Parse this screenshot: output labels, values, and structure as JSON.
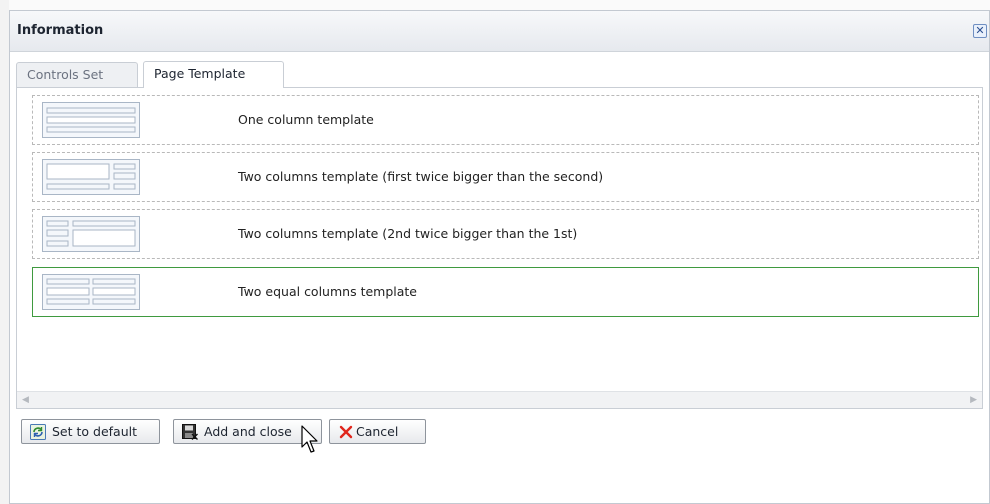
{
  "dialog": {
    "title": "Information"
  },
  "tabs": [
    {
      "label": "Controls Set",
      "active": false
    },
    {
      "label": "Page Template",
      "active": true
    }
  ],
  "templates": [
    {
      "label": "One column template",
      "selected": false,
      "thumb": "one-column"
    },
    {
      "label": "Two columns template (first twice bigger than the second)",
      "selected": false,
      "thumb": "wide-narrow"
    },
    {
      "label": "Two columns template (2nd twice bigger than the 1st)",
      "selected": false,
      "thumb": "narrow-wide"
    },
    {
      "label": "Two equal columns template",
      "selected": true,
      "thumb": "equal-columns"
    }
  ],
  "buttons": {
    "set_default": "Set to default",
    "add_close": "Add and close",
    "cancel": "Cancel"
  },
  "icons": {
    "close": "close-icon",
    "refresh": "refresh-icon",
    "save": "save-icon",
    "cancel": "x-icon"
  },
  "colors": {
    "selected_border": "#3f9a3f",
    "cancel_x": "#e0261c"
  }
}
